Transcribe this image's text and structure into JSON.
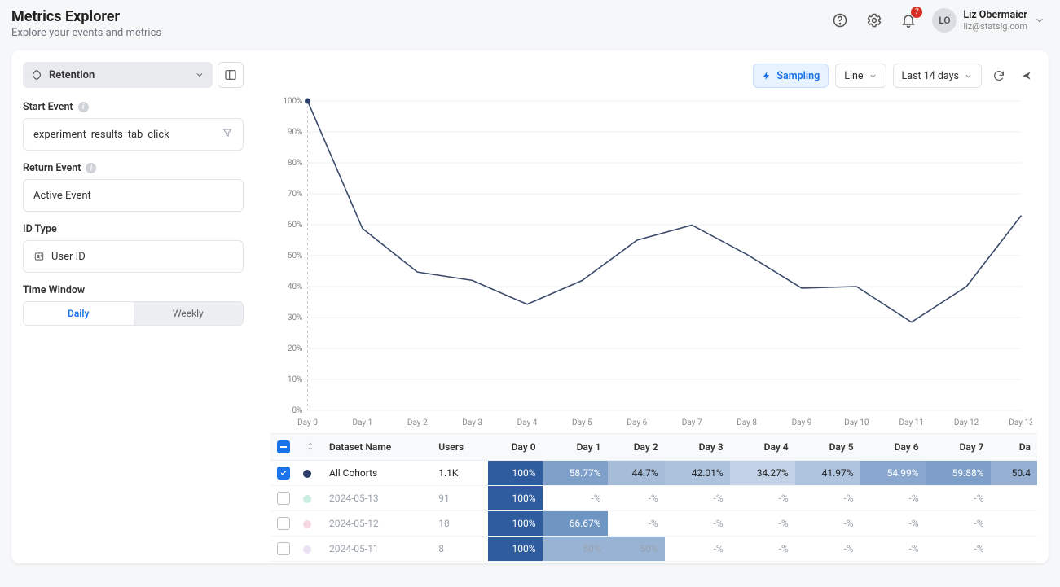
{
  "header": {
    "title": "Metrics Explorer",
    "subtitle": "Explore your events and metrics",
    "notification_count": "7",
    "user": {
      "initials": "LO",
      "name": "Liz Obermaier",
      "email": "liz@statsig.com"
    }
  },
  "sidebar": {
    "mode_label": "Retention",
    "start_event_label": "Start Event",
    "start_event_value": "experiment_results_tab_click",
    "return_event_label": "Return Event",
    "return_event_value": "Active Event",
    "id_type_label": "ID Type",
    "id_type_value": "User ID",
    "time_window_label": "Time Window",
    "toggle_daily": "Daily",
    "toggle_weekly": "Weekly"
  },
  "toolbar": {
    "sampling": "Sampling",
    "chart_type": "Line",
    "range": "Last 14 days"
  },
  "chart_data": {
    "type": "line",
    "title": "",
    "xlabel": "",
    "ylabel": "",
    "ylim": [
      0,
      100
    ],
    "y_ticks": [
      0,
      10,
      20,
      30,
      40,
      50,
      60,
      70,
      80,
      90,
      100
    ],
    "categories": [
      "Day 0",
      "Day 1",
      "Day 2",
      "Day 3",
      "Day 4",
      "Day 5",
      "Day 6",
      "Day 7",
      "Day 8",
      "Day 9",
      "Day 10",
      "Day 11",
      "Day 12",
      "Day 13"
    ],
    "values": [
      100,
      58.77,
      44.7,
      42.01,
      34.27,
      41.97,
      54.99,
      59.88,
      50.4,
      39.5,
      40,
      28.5,
      40,
      63
    ]
  },
  "table": {
    "header_checkbox": "indeterminate",
    "cols": [
      "Dataset Name",
      "Users",
      "Day 0",
      "Day 1",
      "Day 2",
      "Day 3",
      "Day 4",
      "Day 5",
      "Day 6",
      "Day 7",
      "Da"
    ],
    "rows": [
      {
        "checked": true,
        "dot": "#2c3e66",
        "name": "All Cohorts",
        "users": "1.1K",
        "cells": [
          {
            "v": "100%",
            "bg": "#2e5c9e",
            "fg": "#fff"
          },
          {
            "v": "58.77%",
            "bg": "#7fa0c9",
            "fg": "#fff"
          },
          {
            "v": "44.7%",
            "bg": "#a6bdda"
          },
          {
            "v": "42.01%",
            "bg": "#acc2dd"
          },
          {
            "v": "34.27%",
            "bg": "#c3d2e6"
          },
          {
            "v": "41.97%",
            "bg": "#aec3de"
          },
          {
            "v": "54.99%",
            "bg": "#8aa8cf",
            "fg": "#fff"
          },
          {
            "v": "59.88%",
            "bg": "#7d9fc9",
            "fg": "#fff"
          },
          {
            "v": "50.4",
            "bg": "#94afd2"
          }
        ]
      },
      {
        "checked": false,
        "dot": "#c9ede0",
        "name": "2024-05-13",
        "users": "91",
        "cells": [
          {
            "v": "100%",
            "bg": "#2e5c9e",
            "fg": "#fff"
          },
          {
            "v": "-%"
          },
          {
            "v": "-%"
          },
          {
            "v": "-%"
          },
          {
            "v": "-%"
          },
          {
            "v": "-%"
          },
          {
            "v": "-%"
          },
          {
            "v": "-%"
          },
          {
            "v": ""
          }
        ]
      },
      {
        "checked": false,
        "dot": "#f6d7e2",
        "name": "2024-05-12",
        "users": "18",
        "cells": [
          {
            "v": "100%",
            "bg": "#2e5c9e",
            "fg": "#fff"
          },
          {
            "v": "66.67%",
            "bg": "#6f95c3",
            "fg": "#fff"
          },
          {
            "v": "-%"
          },
          {
            "v": "-%"
          },
          {
            "v": "-%"
          },
          {
            "v": "-%"
          },
          {
            "v": "-%"
          },
          {
            "v": "-%"
          },
          {
            "v": ""
          }
        ]
      },
      {
        "checked": false,
        "dot": "#e9e0f3",
        "name": "2024-05-11",
        "users": "8",
        "cells": [
          {
            "v": "100%",
            "bg": "#2e5c9e",
            "fg": "#fff"
          },
          {
            "v": "50%",
            "bg": "#99b3d4"
          },
          {
            "v": "50%",
            "bg": "#99b3d4"
          },
          {
            "v": "-%"
          },
          {
            "v": "-%"
          },
          {
            "v": "-%"
          },
          {
            "v": "-%"
          },
          {
            "v": "-%"
          },
          {
            "v": ""
          }
        ]
      }
    ]
  }
}
